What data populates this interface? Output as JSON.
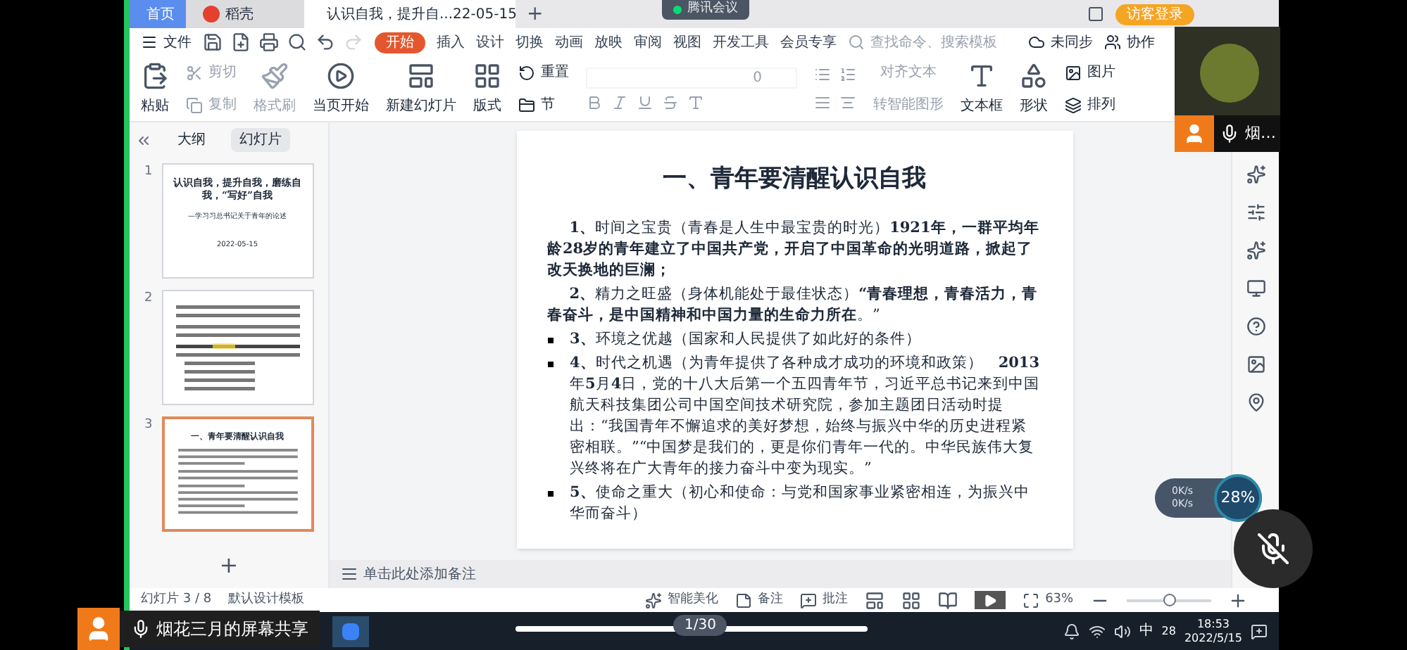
{
  "tabs": [
    {
      "label": "首页",
      "selected": false,
      "kind": "home"
    },
    {
      "label": "稻壳",
      "selected": false,
      "kind": "docer"
    },
    {
      "label": "认识自我，提升自...22-05-15",
      "selected": true,
      "kind": "doc"
    }
  ],
  "new_tab": "+",
  "meeting_badge": "腾讯会议",
  "guest_login": "访客登录",
  "menu": {
    "file": "文件",
    "tabs": [
      {
        "label": "开始",
        "selected": true
      },
      {
        "label": "插入",
        "selected": false
      },
      {
        "label": "设计",
        "selected": false
      },
      {
        "label": "切换",
        "selected": false
      },
      {
        "label": "动画",
        "selected": false
      },
      {
        "label": "放映",
        "selected": false
      },
      {
        "label": "审阅",
        "selected": false
      },
      {
        "label": "视图",
        "selected": false
      },
      {
        "label": "开发工具",
        "selected": false
      },
      {
        "label": "会员专享",
        "selected": false
      }
    ],
    "search_placeholder": "查找命令、搜索模板",
    "sync": "未同步",
    "collab": "协作"
  },
  "ribbon": {
    "paste": "粘贴",
    "cut": "剪切",
    "copy": "复制",
    "format_painter": "格式刷",
    "play_from_current": "当页开始",
    "new_slide": "新建幻灯片",
    "layout": "版式",
    "section": "节",
    "reset": "重置",
    "font_size": "0",
    "align_text": "对齐文本",
    "smart_art": "转智能图形",
    "text_box": "文本框",
    "shape": "形状",
    "picture": "图片",
    "arrange": "排列"
  },
  "panel": {
    "tabs": [
      {
        "label": "大纲",
        "selected": false
      },
      {
        "label": "幻灯片",
        "selected": true
      }
    ],
    "thumbnails": [
      {
        "number": "1",
        "selected": false,
        "kind": "title",
        "title": "认识自我，提升自我，磨练自我，“写好”自我",
        "subtitle": "—学习习总书记关于青年的论述",
        "date": "2022-05-15"
      },
      {
        "number": "2",
        "selected": false,
        "kind": "text"
      },
      {
        "number": "3",
        "selected": true,
        "kind": "heading",
        "title": "一、青年要清醒认识自我"
      }
    ],
    "add": "+"
  },
  "slide": {
    "title": "一、青年要清醒认识自我",
    "paragraphs": [
      {
        "bullet": false,
        "text": "**1、**时间之宝贵（青春是人生中最宝贵的时光）**1921年，一群平均年龄28岁的青年建立了中国共产党，开启了中国革命的光明道路，掀起了改天换地的巨澜；**"
      },
      {
        "bullet": false,
        "text": "**2、**精力之旺盛（身体机能处于最佳状态）**“青春理想，青春活力，青春奋斗，是中国精神和中国力量的生命力所在**。”"
      },
      {
        "bullet": true,
        "text": "**3、**环境之优越（国家和人民提供了如此好的条件）"
      },
      {
        "bullet": true,
        "text": "**4、**时代之机遇（为青年提供了各种成才成功的环境和政策）　**2013**年**5**月**4**日，党的十八大后第一个五四青年节，习近平总书记来到中国航天科技集团公司中国空间技术研究院，参加主题团日活动时提出：“我国青年不懈追求的美好梦想，始终与振兴中华的历史进程紧密相联。”“中国梦是我们的，更是你们青年一代的。中华民族伟大复兴终将在广大青年的接力奋斗中变为现实。”"
      },
      {
        "bullet": true,
        "text": "**5、**使命之重大（初心和使命：与党和国家事业紧密相连，为振兴中华而奋斗）"
      }
    ]
  },
  "notes_placeholder": "单击此处添加备注",
  "status": {
    "slide_counter": "幻灯片 3 / 8",
    "template": "默认设计模板",
    "beautify": "智能美化",
    "notes": "备注",
    "comments": "批注",
    "zoom": "63%",
    "zoom_slider": {
      "level": 0.5
    }
  },
  "taskbar": {
    "ime": "中",
    "badge": "28",
    "time": "18:53",
    "date": "2022/5/15"
  },
  "overlays": {
    "share_label": "烟花三月的屏幕共享",
    "page_pill": "1/30",
    "video_name": "烟…",
    "net_up": "0K/s",
    "net_down": "0K/s",
    "net_percent": "28%"
  }
}
